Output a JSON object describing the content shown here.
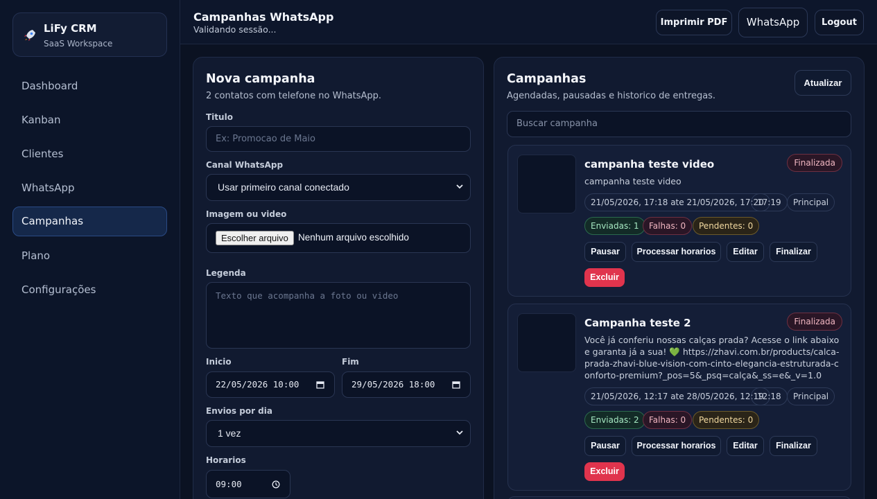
{
  "brand": {
    "name": "LiFy CRM",
    "subtitle": "SaaS Workspace",
    "icon": "rocket-icon"
  },
  "sidebar": {
    "items": [
      {
        "label": "Dashboard"
      },
      {
        "label": "Kanban"
      },
      {
        "label": "Clientes"
      },
      {
        "label": "WhatsApp"
      },
      {
        "label": "Campanhas",
        "active": true
      },
      {
        "label": "Plano"
      },
      {
        "label": "Configurações"
      }
    ]
  },
  "header": {
    "title": "Campanhas WhatsApp",
    "subtitle": "Validando sessão...",
    "print_label": "Imprimir PDF",
    "whatsapp_label": "WhatsApp",
    "logout_label": "Logout"
  },
  "form": {
    "title": "Nova campanha",
    "subtitle": "2 contatos com telefone no WhatsApp.",
    "title_label": "Titulo",
    "title_placeholder": "Ex: Promocao de Maio",
    "channel_label": "Canal WhatsApp",
    "channel_value": "Usar primeiro canal conectado",
    "media_label": "Imagem ou video",
    "file_button": "Escolher arquivo",
    "file_status": "Nenhum arquivo escolhido",
    "caption_label": "Legenda",
    "caption_placeholder": "Texto que acompanha a foto ou video",
    "start_label": "Inicio",
    "start_value": "22/05/2026 10:00",
    "end_label": "Fim",
    "end_value": "29/05/2026 18:00",
    "per_day_label": "Envios por dia",
    "per_day_value": "1 vez",
    "times_label": "Horarios",
    "time_value": "09:00"
  },
  "campaigns": {
    "title": "Campanhas",
    "subtitle": "Agendadas, pausadas e historico de entregas.",
    "refresh_label": "Atualizar",
    "search_placeholder": "Buscar campanha",
    "items": [
      {
        "title": "campanha teste video",
        "description": "campanha teste video",
        "status": "Finalizada",
        "period": "21/05/2026, 17:18 ate 21/05/2026, 17:20",
        "time": "17:19",
        "channel": "Principal",
        "sent": "Enviadas: 1",
        "failed": "Falhas: 0",
        "pending": "Pendentes: 0",
        "pause": "Pausar",
        "process": "Processar horarios",
        "edit": "Editar",
        "finish": "Finalizar",
        "delete": "Excluir"
      },
      {
        "title": "Campanha teste 2",
        "description": "Você já conferiu nossas calças prada? Acesse o link abaixo e garanta já a sua! 💚 https://zhavi.com.br/products/calca-prada-zhavi-blue-vision-com-cinto-elegancia-estruturada-conforto-premium?_pos=5&_psq=calça&_ss=e&_v=1.0",
        "status": "Finalizada",
        "period": "21/05/2026, 12:17 ate 28/05/2026, 12:19",
        "time": "12:18",
        "channel": "Principal",
        "sent": "Enviadas: 2",
        "failed": "Falhas: 0",
        "pending": "Pendentes: 0",
        "pause": "Pausar",
        "process": "Processar horarios",
        "edit": "Editar",
        "finish": "Finalizar",
        "delete": "Excluir"
      }
    ]
  },
  "colors": {
    "accent": "#15284a",
    "danger": "#e0344d",
    "background": "#0b1222"
  }
}
